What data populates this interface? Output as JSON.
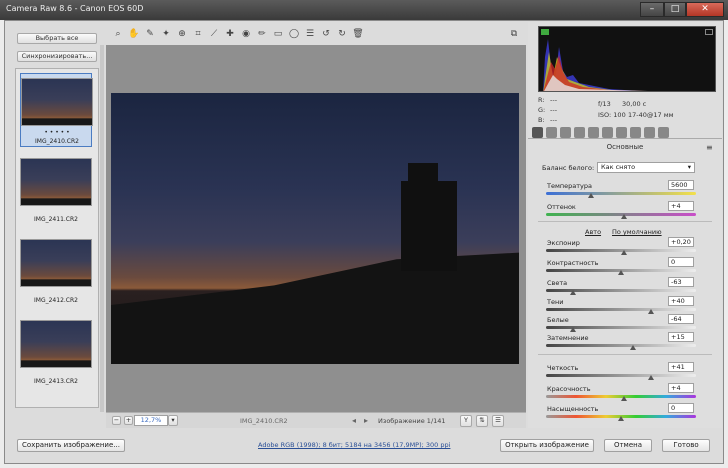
{
  "window": {
    "title": "Camera Raw 8.6  -  Canon EOS 60D",
    "min": "–",
    "max": "□",
    "close": "✕"
  },
  "filmstrip": {
    "select_all": "Выбрать все",
    "synchronize": "Синхронизировать...",
    "thumbs": [
      {
        "name": "IMG_2410.CR2",
        "stars": "• • • • •",
        "selected": true
      },
      {
        "name": "IMG_2411.CR2",
        "selected": false
      },
      {
        "name": "IMG_2412.CR2",
        "selected": false
      },
      {
        "name": "IMG_2413.CR2",
        "selected": false
      }
    ]
  },
  "toolbar": {
    "icons": [
      "zoom-icon",
      "hand-icon",
      "white-balance-icon",
      "color-sampler-icon",
      "target-adjust-icon",
      "crop-icon",
      "straighten-icon",
      "spot-removal-icon",
      "red-eye-icon",
      "adjustment-brush-icon",
      "graduated-filter-icon",
      "radial-filter-icon",
      "preferences-icon",
      "rotate-ccw-icon",
      "rotate-cw-icon",
      "trash-icon"
    ]
  },
  "status": {
    "zoom": "12,7%",
    "filename": "IMG_2410.CR2",
    "counter": "Изображение 1/141"
  },
  "camera_info": {
    "r_label": "R:",
    "g_label": "G:",
    "b_label": "B:",
    "r": "---",
    "g": "---",
    "b": "---",
    "aperture": "f/13",
    "shutter": "30,00 с",
    "iso": "ISO: 100",
    "lens": "17-40@17 мм"
  },
  "panel": {
    "title": "Основные",
    "wb_label": "Баланс белого:",
    "wb_value": "Как снято",
    "auto": "Авто",
    "default": "По умолчанию",
    "sliders": [
      {
        "label": "Температура",
        "value": "5600",
        "pos": 0.3,
        "track": "temp"
      },
      {
        "label": "Оттенок",
        "value": "+4",
        "pos": 0.52,
        "track": "tint"
      },
      {
        "label": "Экспонир",
        "value": "+0,20",
        "pos": 0.52,
        "track": "gray"
      },
      {
        "label": "Контрастность",
        "value": "0",
        "pos": 0.5,
        "track": "gray"
      },
      {
        "label": "Света",
        "value": "-63",
        "pos": 0.18,
        "track": "gray"
      },
      {
        "label": "Тени",
        "value": "+40",
        "pos": 0.7,
        "track": "gray"
      },
      {
        "label": "Белые",
        "value": "-64",
        "pos": 0.18,
        "track": "gray"
      },
      {
        "label": "Затемнение",
        "value": "+15",
        "pos": 0.58,
        "track": "gray"
      },
      {
        "label": "Четкость",
        "value": "+41",
        "pos": 0.7,
        "track": "gray"
      },
      {
        "label": "Красочность",
        "value": "+4",
        "pos": 0.52,
        "track": "color"
      },
      {
        "label": "Насыщенность",
        "value": "0",
        "pos": 0.5,
        "track": "color"
      }
    ]
  },
  "bottom": {
    "save": "Сохранить изображение...",
    "workflow": "Adobe RGB (1998); 8 бит; 5184 на 3456 (17,9МР); 300 ppi",
    "open": "Открыть изображение",
    "cancel": "Отмена",
    "done": "Готово"
  }
}
